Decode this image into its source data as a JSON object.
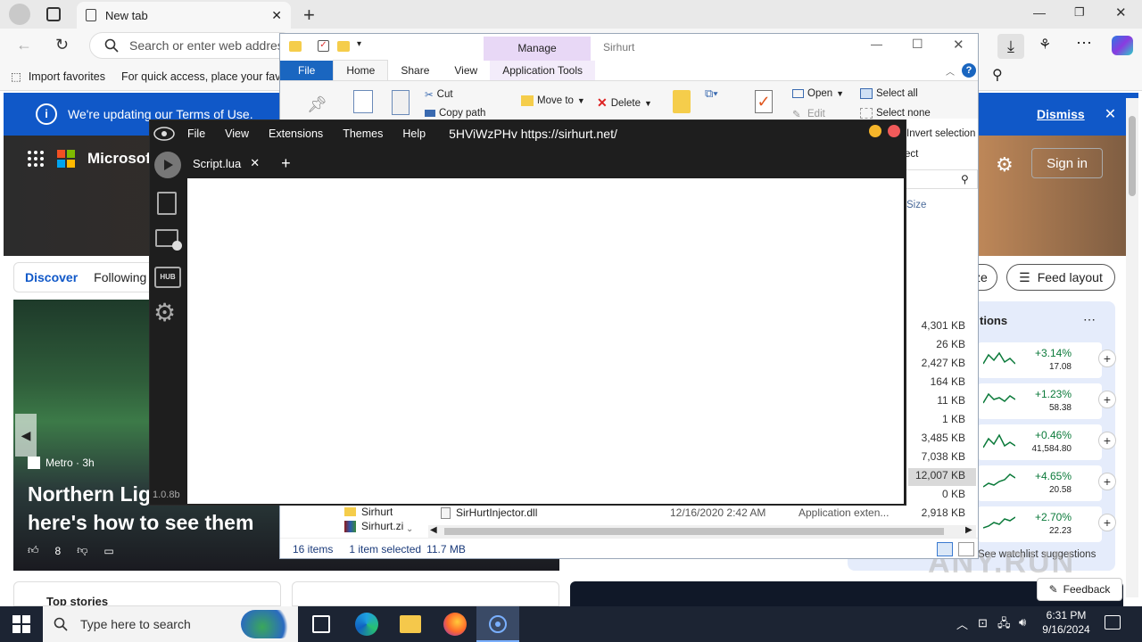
{
  "browser": {
    "tab_title": "New tab",
    "address_placeholder": "Search or enter web address",
    "favorites": {
      "import": "Import favorites",
      "hint": "For quick access, place your favorites here on the favorites bar."
    },
    "notice": {
      "text": "We're updating our Terms of Use.",
      "dismiss": "Dismiss"
    }
  },
  "msn": {
    "brand": "Microsoft Start",
    "sign_in": "Sign in",
    "tabs": [
      "Discover",
      "Following"
    ],
    "personalize": "ze",
    "feed_layout": "Feed layout",
    "story": {
      "source": "Metro · 3h",
      "headline_line1": "Northern Lights",
      "headline_line2": "here's how to see them",
      "likes": "8"
    },
    "watchlist_title": "tions",
    "watchlist_suggestions": "See watchlist suggestions",
    "watchlist": [
      {
        "pct": "+3.14%",
        "price": "17.08"
      },
      {
        "pct": "+1.23%",
        "price": "58.38"
      },
      {
        "pct": "+0.46%",
        "price": "41,584.80"
      },
      {
        "pct": "+4.65%",
        "price": "20.58"
      },
      {
        "pct": "+2.70%",
        "price": "22.23"
      }
    ],
    "top_stories": "Top stories",
    "feedback": "Feedback"
  },
  "explorer": {
    "title": "Sirhurt",
    "manage": "Manage",
    "tabs": [
      "File",
      "Home",
      "Share",
      "View",
      "Application Tools"
    ],
    "ribbon": {
      "cut": "Cut",
      "copy_path": "Copy path",
      "move_to": "Move to",
      "delete": "Delete",
      "open": "Open",
      "edit": "Edit",
      "select_all": "Select all",
      "select_none": "Select none",
      "invert": "Invert selection",
      "select": "ect"
    },
    "size_header": "Size",
    "sizes": [
      "4,301 KB",
      "26 KB",
      "2,427 KB",
      "164 KB",
      "11 KB",
      "1 KB",
      "3,485 KB",
      "7,038 KB",
      "12,007 KB",
      "0 KB",
      "2,918 KB"
    ],
    "row_name": "SirHurtInjector.dll",
    "row_date": "12/16/2020 2:42 AM",
    "row_type": "Application exten...",
    "nav_items": [
      "Sirhurt",
      "Sirhurt.zi"
    ],
    "status": {
      "items": "16 items",
      "selected": "1 item selected",
      "size": "11.7 MB"
    }
  },
  "sirhurt": {
    "menu": [
      "File",
      "View",
      "Extensions",
      "Themes",
      "Help"
    ],
    "banner": "5HViWzPHv https://sirhurt.net/",
    "tab": "Script.lua",
    "version": "1.0.8b"
  },
  "taskbar": {
    "search_placeholder": "Type here to search",
    "time": "6:31 PM",
    "date": "9/16/2024"
  },
  "watermark": "ANY.RUN",
  "colors": {
    "accent": "#1058c8",
    "sirhurt_bg": "#1e1e1e",
    "manage": "#e8d8f6",
    "watchlist_bg": "#e5ecfb"
  }
}
